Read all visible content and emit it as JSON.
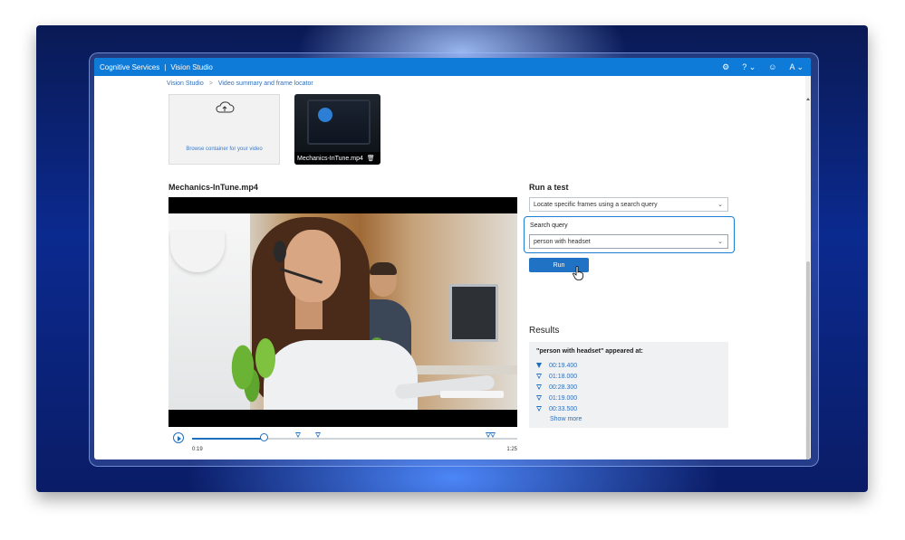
{
  "titlebar": {
    "product": "Cognitive Services",
    "separator": "|",
    "app": "Vision Studio",
    "icons": [
      "gear-icon",
      "help-icon",
      "chevron-down-icon",
      "smiley-icon",
      "account-icon",
      "chevron-down-icon"
    ],
    "account_initial": "A"
  },
  "breadcrumb": {
    "items": [
      "Vision Studio",
      "Video summary and frame locator"
    ],
    "separator": ">"
  },
  "upload": {
    "label": "Browse container for your video"
  },
  "thumbnail": {
    "filename": "Mechanics-InTune.mp4"
  },
  "video": {
    "title": "Mechanics-InTune.mp4",
    "time_start": "0:19",
    "time_end": "1:25",
    "progress_fraction": 0.22
  },
  "run_test": {
    "title": "Run a test",
    "mode_selected": "Locate specific frames using a search query",
    "search_query_label": "Search query",
    "search_query_value": "person with headset",
    "run_label": "Run"
  },
  "results": {
    "title": "Results",
    "heading": "\"person with headset\" appeared at:",
    "timestamps": [
      "00:19.400",
      "01:18.000",
      "00:28.300",
      "01:19.000",
      "00:33.500"
    ],
    "show_more": "Show more"
  },
  "colors": {
    "accent": "#0f7bd8",
    "button": "#1f72c4",
    "link": "#2f6fb8"
  }
}
